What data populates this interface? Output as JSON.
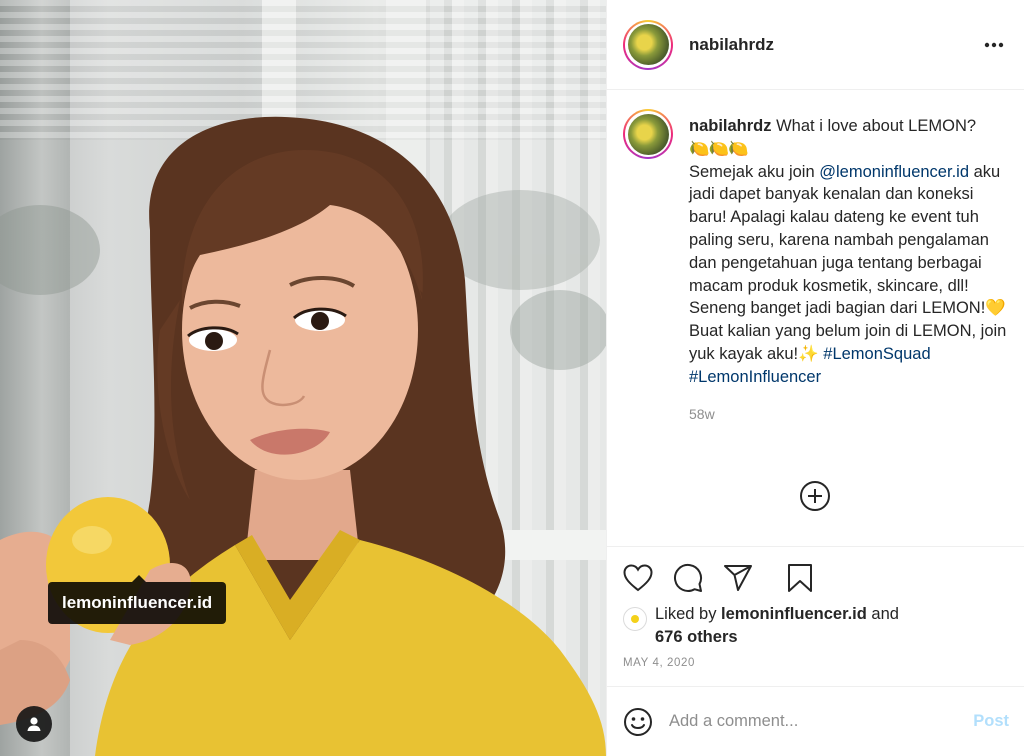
{
  "post": {
    "username": "nabilahrdz",
    "photo_tag": "lemoninfluencer.id"
  },
  "caption": {
    "username": "nabilahrdz",
    "title": "What i love about LEMON?",
    "emojis": "🍋🍋🍋",
    "intro": "Semejak aku join ",
    "mention": "@lemoninfluencer.id",
    "body": " aku jadi dapet banyak kenalan dan koneksi baru! Apalagi kalau dateng ke event tuh paling seru, karena nambah pengalaman dan pengetahuan juga tentang berbagai macam produk kosmetik, skincare, dll! Seneng banget jadi bagian dari LEMON!",
    "heart_emoji": "💛",
    "outro": "Buat kalian yang belum join di LEMON, join yuk kayak aku!",
    "sparkle_emoji": "✨",
    "hashtag1": "#LemonSquad",
    "hashtag2": "#LemonInfluencer",
    "time_ago": "58w"
  },
  "likes": {
    "prefix": "Liked by ",
    "liker": "lemoninfluencer.id",
    "middle": " and",
    "others": "676 others"
  },
  "date": "MAY 4, 2020",
  "comment": {
    "placeholder": "Add a comment...",
    "post_label": "Post"
  },
  "icons": {
    "more": "more-horizontal-icon",
    "load_more": "plus-circle-icon",
    "like": "heart-icon",
    "comment": "comment-bubble-icon",
    "share": "paper-plane-icon",
    "save": "bookmark-icon",
    "emoji": "smiley-icon",
    "user_tag": "person-icon"
  },
  "colors": {
    "link": "#00376b",
    "muted": "#8e8e8e",
    "post_disabled": "#b2dffc",
    "shirt": "#e8c233",
    "lemon": "#f2c83a"
  }
}
